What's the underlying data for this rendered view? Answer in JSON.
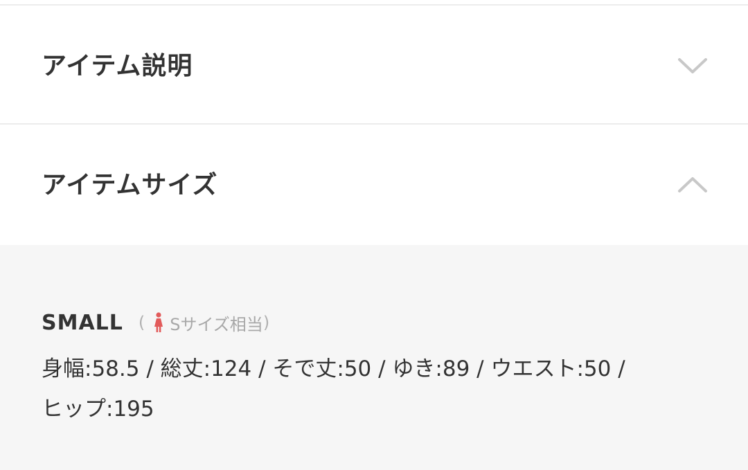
{
  "accordion": {
    "description": {
      "title": "アイテム説明",
      "expanded": false,
      "icon": "chevron-down-icon"
    },
    "size": {
      "title": "アイテムサイズ",
      "expanded": true,
      "icon": "chevron-up-icon"
    }
  },
  "size_panel": {
    "size_name": "SMALL",
    "note_open": "(",
    "note_icon": "woman-figure-icon",
    "note_label": "Sサイズ相当",
    "note_close": ")",
    "measurements_line1": "身幅:58.5 / 総丈:124 / そで丈:50 / ゆき:89 / ウエスト:50 /",
    "measurements_line2": "ヒップ:195"
  },
  "colors": {
    "text": "#333333",
    "muted": "#a8a8a8",
    "chevron": "#c8c8c8",
    "panel_bg": "#f6f6f6",
    "divider": "#ececec",
    "icon_accent": "#e25b5b"
  }
}
